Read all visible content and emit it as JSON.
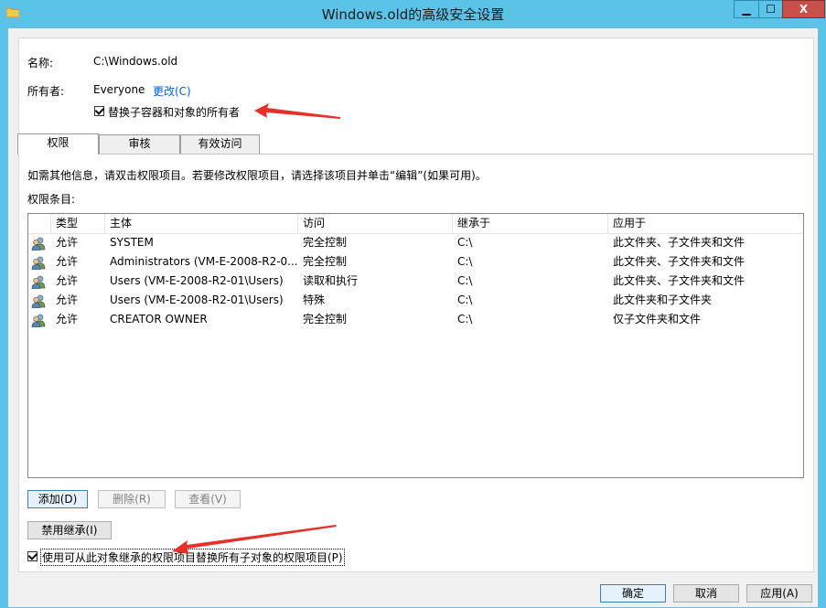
{
  "window": {
    "title": "Windows.old的高级安全设置",
    "min_label": "▁",
    "max_label": "☐",
    "close_label": "X"
  },
  "info": {
    "name_label": "名称:",
    "name_value": "C:\\Windows.old",
    "owner_label": "所有者:",
    "owner_value": "Everyone",
    "change_link": "更改(C)",
    "replace_owner_label": "替换子容器和对象的所有者"
  },
  "tabs": [
    {
      "label": "权限"
    },
    {
      "label": "审核"
    },
    {
      "label": "有效访问"
    }
  ],
  "permissions": {
    "hint": "如需其他信息，请双击权限项目。若要修改权限项目，请选择该项目并单击“编辑”(如果可用)。",
    "entries_label": "权限条目:",
    "columns": [
      "类型",
      "主体",
      "访问",
      "继承于",
      "应用于"
    ],
    "rows": [
      {
        "type": "允许",
        "principal": "SYSTEM",
        "access": "完全控制",
        "inherited": "C:\\",
        "applies": "此文件夹、子文件夹和文件"
      },
      {
        "type": "允许",
        "principal": "Administrators (VM-E-2008-R2-0...",
        "access": "完全控制",
        "inherited": "C:\\",
        "applies": "此文件夹、子文件夹和文件"
      },
      {
        "type": "允许",
        "principal": "Users (VM-E-2008-R2-01\\Users)",
        "access": "读取和执行",
        "inherited": "C:\\",
        "applies": "此文件夹、子文件夹和文件"
      },
      {
        "type": "允许",
        "principal": "Users (VM-E-2008-R2-01\\Users)",
        "access": "特殊",
        "inherited": "C:\\",
        "applies": "此文件夹和子文件夹"
      },
      {
        "type": "允许",
        "principal": "CREATOR OWNER",
        "access": "完全控制",
        "inherited": "C:\\",
        "applies": "仅子文件夹和文件"
      }
    ],
    "add_button": "添加(D)",
    "remove_button": "删除(R)",
    "view_button": "查看(V)",
    "disable_inheritance_button": "禁用继承(I)",
    "replace_child_label": "使用可从此对象继承的权限项目替换所有子对象的权限项目(P)"
  },
  "footer": {
    "ok_button": "确定",
    "cancel_button": "取消",
    "apply_button": "应用(A)"
  },
  "colors": {
    "titlebar": "#5bc3e8",
    "close": "#c7504a",
    "arrow": "#e8302a"
  }
}
